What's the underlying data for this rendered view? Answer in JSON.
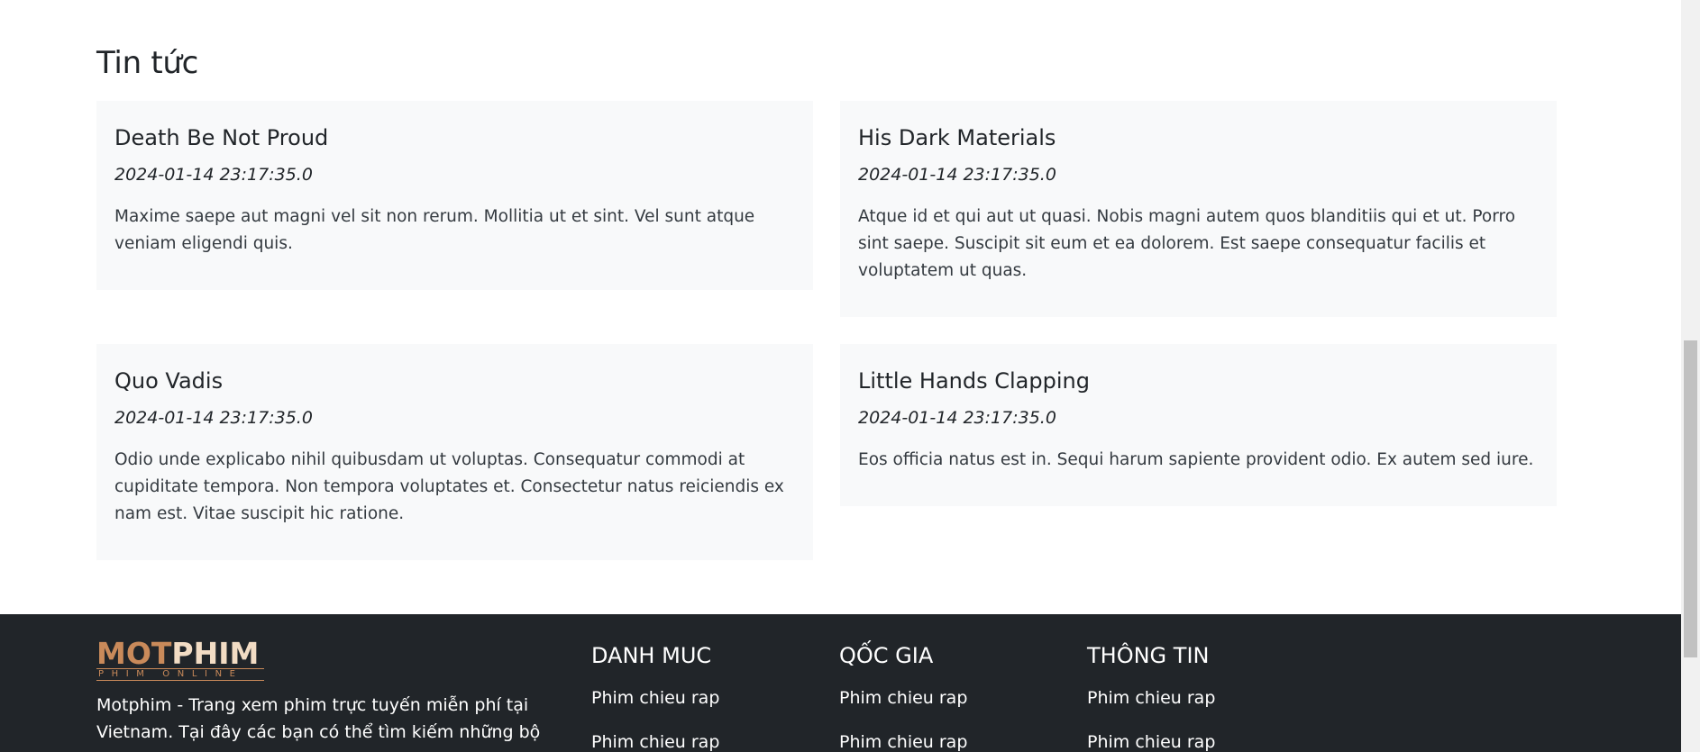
{
  "news": {
    "heading": "Tin tức",
    "items": [
      {
        "title": "Death Be Not Proud",
        "date": "2024-01-14 23:17:35.0",
        "body": "Maxime saepe aut magni vel sit non rerum. Mollitia ut et sint. Vel sunt atque veniam eligendi quis."
      },
      {
        "title": "His Dark Materials",
        "date": "2024-01-14 23:17:35.0",
        "body": "Atque id et qui aut ut quasi. Nobis magni autem quos blanditiis qui et ut. Porro sint saepe. Suscipit sit eum et ea dolorem. Est saepe consequatur facilis et voluptatem ut quas."
      },
      {
        "title": "Quo Vadis",
        "date": "2024-01-14 23:17:35.0",
        "body": "Odio unde explicabo nihil quibusdam ut voluptas. Consequatur commodi at cupiditate tempora. Non tempora voluptates et. Consectetur natus reiciendis ex nam est. Vitae suscipit hic ratione."
      },
      {
        "title": "Little Hands Clapping",
        "date": "2024-01-14 23:17:35.0",
        "body": "Eos officia natus est in. Sequi harum sapiente provident odio. Ex autem sed iure."
      }
    ]
  },
  "footer": {
    "logo": {
      "part1": "MOT",
      "part2": "PHIM",
      "tagline": "PHIM ONLINE"
    },
    "description": "Motphim - Trang xem phim trực tuyến miễn phí tại Vietnam. Tại đây các bạn có thể tìm kiếm những bộ phim",
    "columns": [
      {
        "title": "DANH MUC",
        "links": [
          "Phim chieu rap",
          "Phim chieu rap"
        ]
      },
      {
        "title": "QỐC GIA",
        "links": [
          "Phim chieu rap",
          "Phim chieu rap"
        ]
      },
      {
        "title": "THÔNG TIN",
        "links": [
          "Phim chieu rap",
          "Phim chieu rap"
        ]
      }
    ]
  },
  "colors": {
    "card_background": "#f8f9fa",
    "footer_background": "#212529",
    "logo_accent": "#c98a5a",
    "logo_light": "#f2dcc4"
  }
}
